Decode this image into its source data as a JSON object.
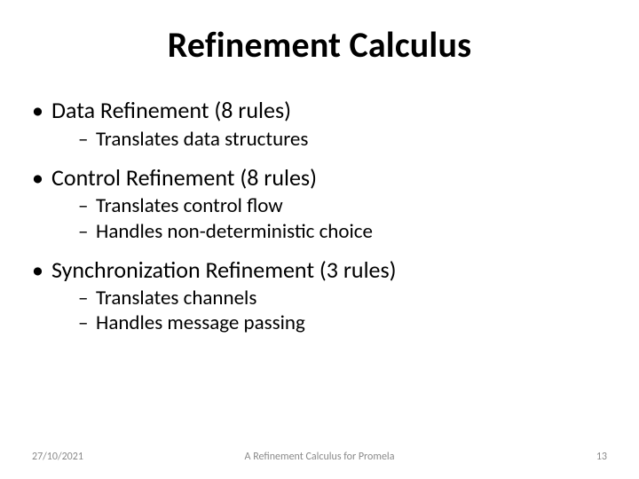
{
  "title": "Refinement Calculus",
  "bullets": {
    "b1": {
      "label": "Data Refinement (8 rules)",
      "subs": {
        "s1": "Translates data structures"
      }
    },
    "b2": {
      "label": "Control Refinement (8 rules)",
      "subs": {
        "s1": "Translates control flow",
        "s2": "Handles non-deterministic choice"
      }
    },
    "b3": {
      "label": "Synchronization Refinement (3 rules)",
      "subs": {
        "s1": "Translates channels",
        "s2": "Handles message passing"
      }
    }
  },
  "footer": {
    "date": "27/10/2021",
    "center": "A Refinement Calculus for Promela",
    "page": "13"
  }
}
